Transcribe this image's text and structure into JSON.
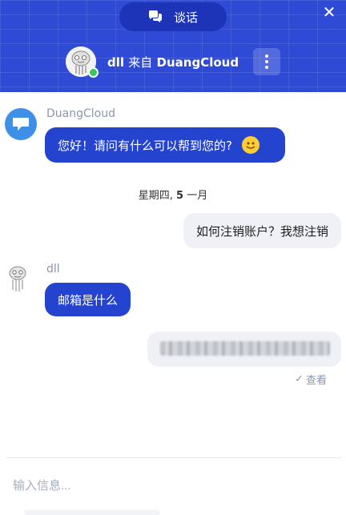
{
  "header": {
    "tab_label": "谈话",
    "close_glyph": "✕",
    "agent_name": "dll",
    "from_text": "来自",
    "org_name": "DuangCloud",
    "online": true,
    "accent_color": "#2f4bd6"
  },
  "messages": {
    "bot_sender": "DuangCloud",
    "greeting": "您好！请问有什么可以帮到您的?",
    "date_weekday": "星期四,",
    "date_day": "5",
    "date_month": "一月",
    "user_message": "如何注销账户？我想注销",
    "agent_sender": "dll",
    "agent_message": "邮箱是什么",
    "seen_label": "查看",
    "seen_glyph": "✓"
  },
  "composer": {
    "placeholder": "输入信息..."
  }
}
